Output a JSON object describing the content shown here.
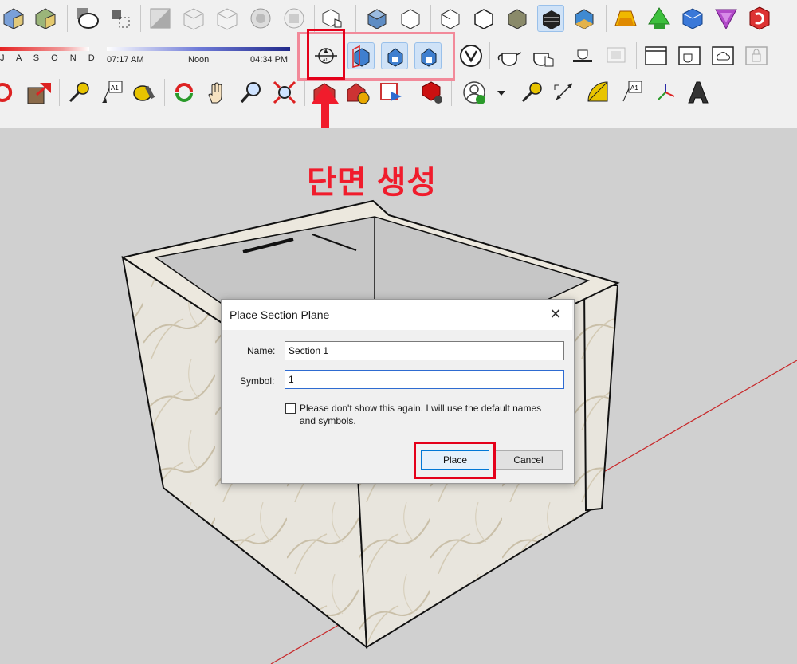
{
  "toolbar": {
    "months_strip": "J A S O N D",
    "time_start": "07:17 AM",
    "time_mid": "Noon",
    "time_end": "04:34 PM",
    "active_style": "#cfe2f7"
  },
  "annotation": {
    "text": "단면 생성",
    "color": "#f01c2c"
  },
  "dialog": {
    "title": "Place Section Plane",
    "name_label": "Name:",
    "name_value": "Section 1",
    "symbol_label": "Symbol:",
    "symbol_value": "1",
    "checkbox_label": "Please don't show this again.  I will use the default names and symbols.",
    "place_label": "Place",
    "cancel_label": "Cancel",
    "close_glyph": "✕"
  },
  "highlight_color": "#e4001a"
}
